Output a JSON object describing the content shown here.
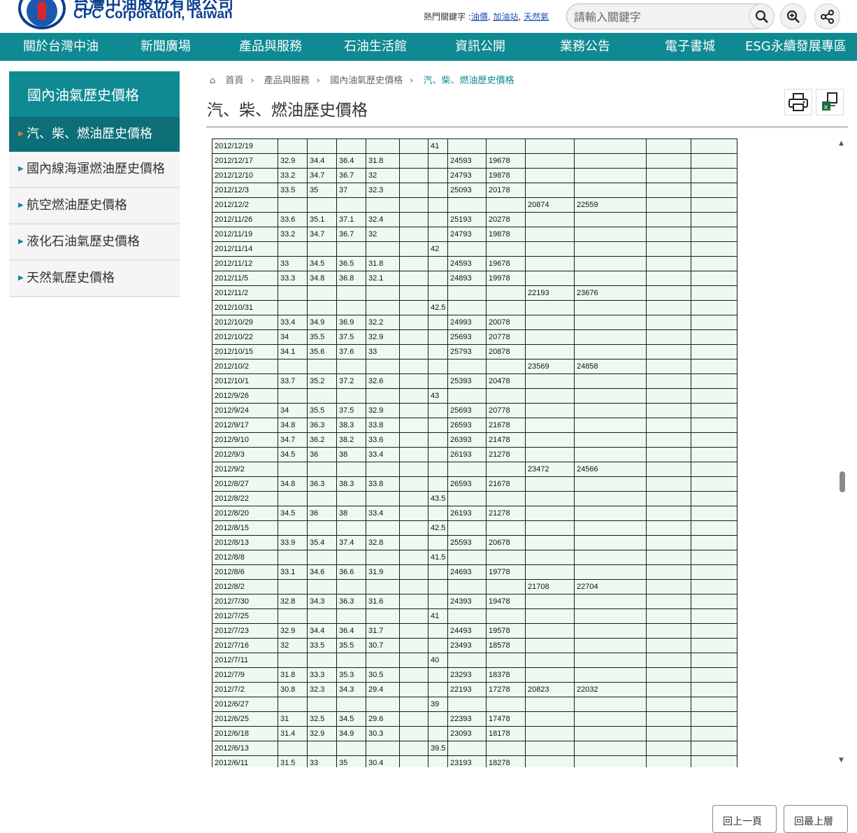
{
  "header": {
    "brand_cn": "台灣中油股份有限公司",
    "brand_en": "CPC Corporation, Taiwan",
    "hot_label": "熱門關鍵字 :",
    "hot_links": [
      "油價",
      "加油站",
      "天然氣"
    ],
    "search_placeholder": "請輸入關鍵字"
  },
  "nav": {
    "items": [
      "關於台灣中油",
      "新聞廣場",
      "產品與服務",
      "石油生活館",
      "資訊公開",
      "業務公告",
      "電子書城",
      "ESG永續發展專區"
    ]
  },
  "sidebar": {
    "title": "國內油氣歷史價格",
    "items": [
      "汽、柴、燃油歷史價格",
      "國內線海運燃油歷史價格",
      "航空燃油歷史價格",
      "液化石油氣歷史價格",
      "天然氣歷史價格"
    ]
  },
  "breadcrumb": [
    "首頁",
    "產品與服務",
    "國內油氣歷史價格",
    "汽、柴、燃油歷史價格"
  ],
  "page_title": "汽、柴、燃油歷史價格",
  "table": {
    "rows": [
      [
        "2012/12/19",
        "",
        "",
        "",
        "",
        "",
        "41",
        "",
        "",
        "",
        "",
        "",
        ""
      ],
      [
        "2012/12/17",
        "32.9",
        "34.4",
        "36.4",
        "31.8",
        "",
        "",
        "24593",
        "19678",
        "",
        "",
        "",
        ""
      ],
      [
        "2012/12/10",
        "33.2",
        "34.7",
        "36.7",
        "32",
        "",
        "",
        "24793",
        "19878",
        "",
        "",
        "",
        ""
      ],
      [
        "2012/12/3",
        "33.5",
        "35",
        "37",
        "32.3",
        "",
        "",
        "25093",
        "20178",
        "",
        "",
        "",
        ""
      ],
      [
        "2012/12/2",
        "",
        "",
        "",
        "",
        "",
        "",
        "",
        "",
        "20874",
        "22559",
        "",
        ""
      ],
      [
        "2012/11/26",
        "33.6",
        "35.1",
        "37.1",
        "32.4",
        "",
        "",
        "25193",
        "20278",
        "",
        "",
        "",
        ""
      ],
      [
        "2012/11/19",
        "33.2",
        "34.7",
        "36.7",
        "32",
        "",
        "",
        "24793",
        "19878",
        "",
        "",
        "",
        ""
      ],
      [
        "2012/11/14",
        "",
        "",
        "",
        "",
        "",
        "42",
        "",
        "",
        "",
        "",
        "",
        ""
      ],
      [
        "2012/11/12",
        "33",
        "34.5",
        "36.5",
        "31.8",
        "",
        "",
        "24593",
        "19678",
        "",
        "",
        "",
        ""
      ],
      [
        "2012/11/5",
        "33.3",
        "34.8",
        "36.8",
        "32.1",
        "",
        "",
        "24893",
        "19978",
        "",
        "",
        "",
        ""
      ],
      [
        "2012/11/2",
        "",
        "",
        "",
        "",
        "",
        "",
        "",
        "",
        "22193",
        "23676",
        "",
        ""
      ],
      [
        "2012/10/31",
        "",
        "",
        "",
        "",
        "",
        "42.5",
        "",
        "",
        "",
        "",
        "",
        ""
      ],
      [
        "2012/10/29",
        "33.4",
        "34.9",
        "36.9",
        "32.2",
        "",
        "",
        "24993",
        "20078",
        "",
        "",
        "",
        ""
      ],
      [
        "2012/10/22",
        "34",
        "35.5",
        "37.5",
        "32.9",
        "",
        "",
        "25693",
        "20778",
        "",
        "",
        "",
        ""
      ],
      [
        "2012/10/15",
        "34.1",
        "35.6",
        "37.6",
        "33",
        "",
        "",
        "25793",
        "20878",
        "",
        "",
        "",
        ""
      ],
      [
        "2012/10/2",
        "",
        "",
        "",
        "",
        "",
        "",
        "",
        "",
        "23569",
        "24858",
        "",
        ""
      ],
      [
        "2012/10/1",
        "33.7",
        "35.2",
        "37.2",
        "32.6",
        "",
        "",
        "25393",
        "20478",
        "",
        "",
        "",
        ""
      ],
      [
        "2012/9/26",
        "",
        "",
        "",
        "",
        "",
        "43",
        "",
        "",
        "",
        "",
        "",
        ""
      ],
      [
        "2012/9/24",
        "34",
        "35.5",
        "37.5",
        "32.9",
        "",
        "",
        "25693",
        "20778",
        "",
        "",
        "",
        ""
      ],
      [
        "2012/9/17",
        "34.8",
        "36.3",
        "38.3",
        "33.8",
        "",
        "",
        "26593",
        "21678",
        "",
        "",
        "",
        ""
      ],
      [
        "2012/9/10",
        "34.7",
        "36.2",
        "38.2",
        "33.6",
        "",
        "",
        "26393",
        "21478",
        "",
        "",
        "",
        ""
      ],
      [
        "2012/9/3",
        "34.5",
        "36",
        "38",
        "33.4",
        "",
        "",
        "26193",
        "21278",
        "",
        "",
        "",
        ""
      ],
      [
        "2012/9/2",
        "",
        "",
        "",
        "",
        "",
        "",
        "",
        "",
        "23472",
        "24566",
        "",
        ""
      ],
      [
        "2012/8/27",
        "34.8",
        "36.3",
        "38.3",
        "33.8",
        "",
        "",
        "26593",
        "21678",
        "",
        "",
        "",
        ""
      ],
      [
        "2012/8/22",
        "",
        "",
        "",
        "",
        "",
        "43.5",
        "",
        "",
        "",
        "",
        "",
        ""
      ],
      [
        "2012/8/20",
        "34.5",
        "36",
        "38",
        "33.4",
        "",
        "",
        "26193",
        "21278",
        "",
        "",
        "",
        ""
      ],
      [
        "2012/8/15",
        "",
        "",
        "",
        "",
        "",
        "42.5",
        "",
        "",
        "",
        "",
        "",
        ""
      ],
      [
        "2012/8/13",
        "33.9",
        "35.4",
        "37.4",
        "32.8",
        "",
        "",
        "25593",
        "20678",
        "",
        "",
        "",
        ""
      ],
      [
        "2012/8/8",
        "",
        "",
        "",
        "",
        "",
        "41.5",
        "",
        "",
        "",
        "",
        "",
        ""
      ],
      [
        "2012/8/6",
        "33.1",
        "34.6",
        "36.6",
        "31.9",
        "",
        "",
        "24693",
        "19778",
        "",
        "",
        "",
        ""
      ],
      [
        "2012/8/2",
        "",
        "",
        "",
        "",
        "",
        "",
        "",
        "",
        "21708",
        "22704",
        "",
        ""
      ],
      [
        "2012/7/30",
        "32.8",
        "34.3",
        "36.3",
        "31.6",
        "",
        "",
        "24393",
        "19478",
        "",
        "",
        "",
        ""
      ],
      [
        "2012/7/25",
        "",
        "",
        "",
        "",
        "",
        "41",
        "",
        "",
        "",
        "",
        "",
        ""
      ],
      [
        "2012/7/23",
        "32.9",
        "34.4",
        "36.4",
        "31.7",
        "",
        "",
        "24493",
        "19578",
        "",
        "",
        "",
        ""
      ],
      [
        "2012/7/16",
        "32",
        "33.5",
        "35.5",
        "30.7",
        "",
        "",
        "23493",
        "18578",
        "",
        "",
        "",
        ""
      ],
      [
        "2012/7/11",
        "",
        "",
        "",
        "",
        "",
        "40",
        "",
        "",
        "",
        "",
        "",
        ""
      ],
      [
        "2012/7/9",
        "31.8",
        "33.3",
        "35.3",
        "30.5",
        "",
        "",
        "23293",
        "18378",
        "",
        "",
        "",
        ""
      ],
      [
        "2012/7/2",
        "30.8",
        "32.3",
        "34.3",
        "29.4",
        "",
        "",
        "22193",
        "17278",
        "20823",
        "22032",
        "",
        ""
      ],
      [
        "2012/6/27",
        "",
        "",
        "",
        "",
        "",
        "39",
        "",
        "",
        "",
        "",
        "",
        ""
      ],
      [
        "2012/6/25",
        "31",
        "32.5",
        "34.5",
        "29.6",
        "",
        "",
        "22393",
        "17478",
        "",
        "",
        "",
        ""
      ],
      [
        "2012/6/18",
        "31.4",
        "32.9",
        "34.9",
        "30.3",
        "",
        "",
        "23093",
        "18178",
        "",
        "",
        "",
        ""
      ],
      [
        "2012/6/13",
        "",
        "",
        "",
        "",
        "",
        "39.5",
        "",
        "",
        "",
        "",
        "",
        ""
      ],
      [
        "2012/6/11",
        "31.5",
        "33",
        "35",
        "30.4",
        "",
        "",
        "23193",
        "18278",
        "",
        "",
        "",
        ""
      ]
    ]
  },
  "pager": {
    "prev_label": "回上一頁",
    "top_label": "回最上層"
  },
  "icons": [
    "search-icon",
    "zoom-icon",
    "share-icon",
    "print-icon",
    "excel-icon",
    "home-icon"
  ]
}
